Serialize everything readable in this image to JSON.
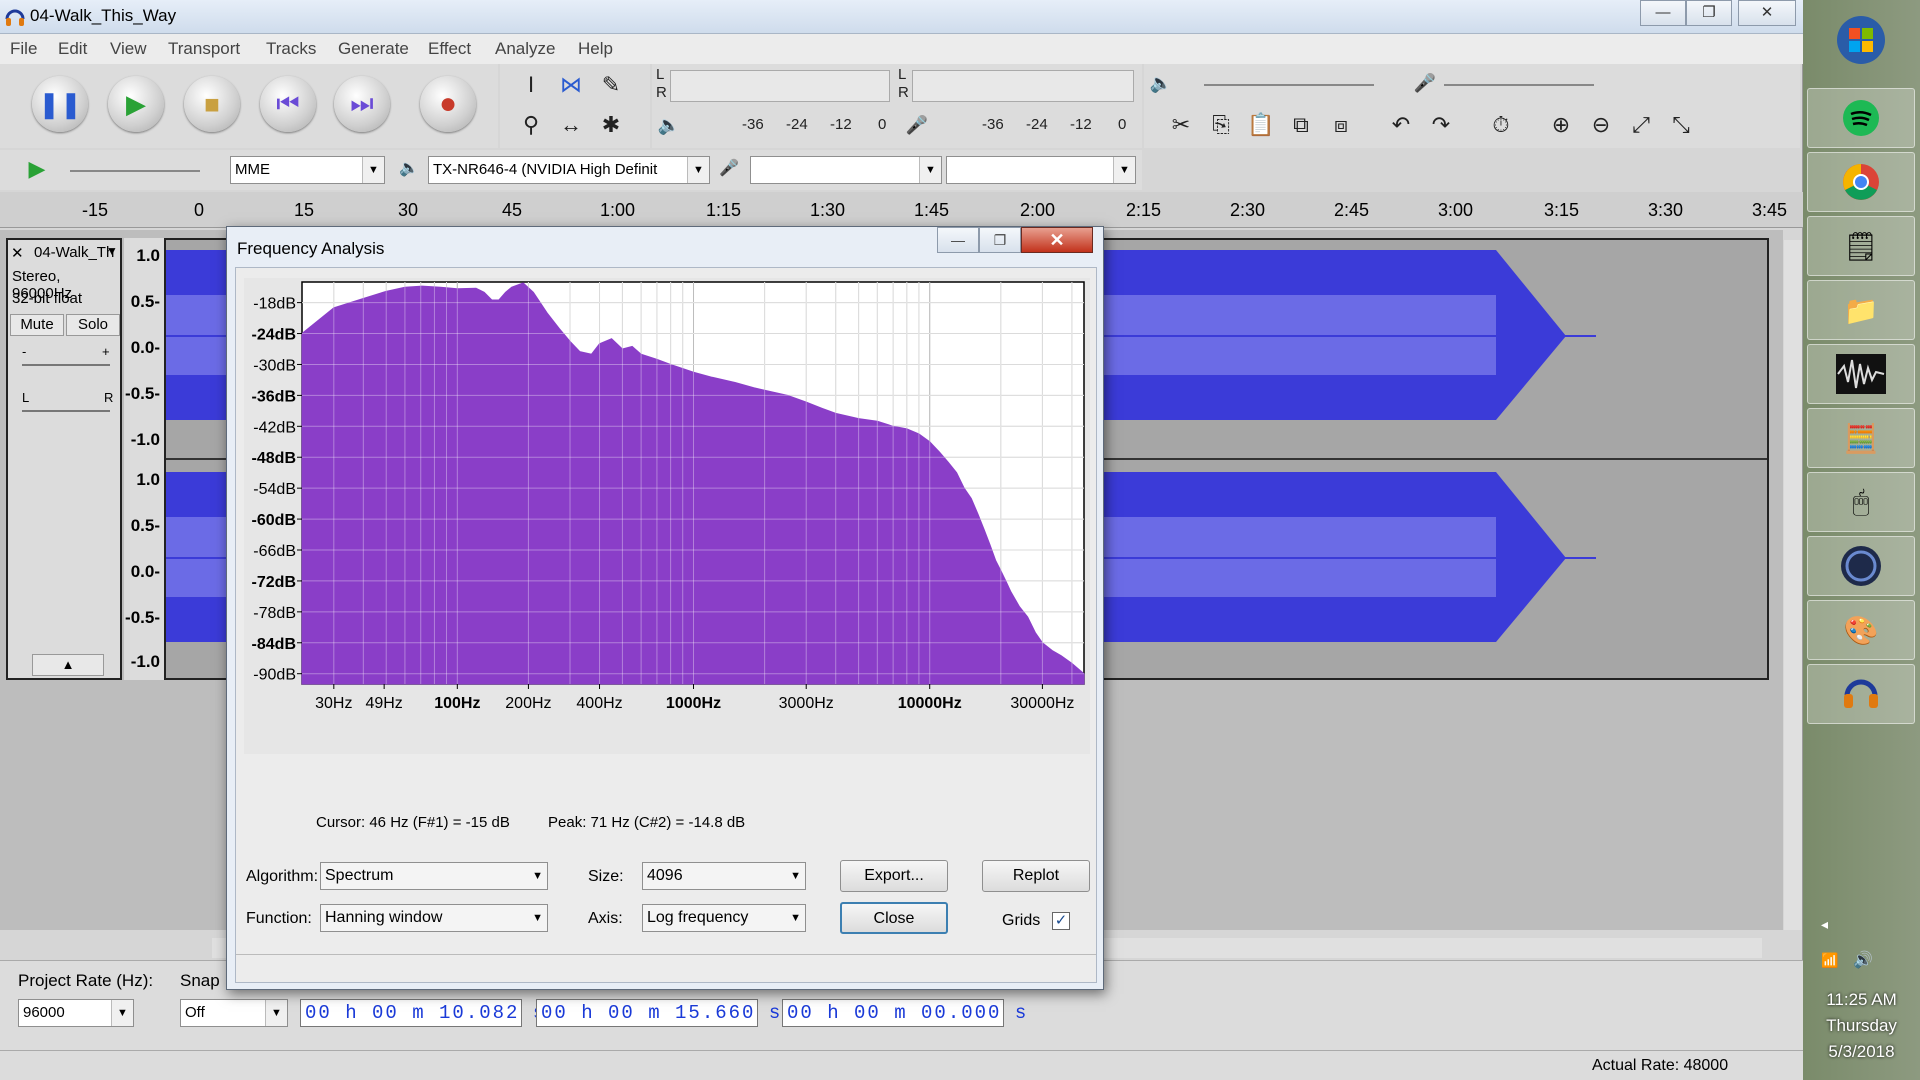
{
  "window": {
    "title": "04-Walk_This_Way",
    "menu": [
      "File",
      "Edit",
      "View",
      "Transport",
      "Tracks",
      "Generate",
      "Effect",
      "Analyze",
      "Help"
    ]
  },
  "meters": {
    "rec_ticks": [
      "-36",
      "-24",
      "-12",
      "0"
    ],
    "play_ticks": [
      "-36",
      "-24",
      "-12",
      "0"
    ],
    "channel_L": "L",
    "channel_R": "R"
  },
  "device": {
    "host": "MME",
    "output": "TX-NR646-4 (NVIDIA High Definit",
    "input": "",
    "channels": ""
  },
  "timeline": {
    "ticks": [
      "-15",
      "0",
      "15",
      "30",
      "45",
      "1:00",
      "1:15",
      "1:30",
      "1:45",
      "2:00",
      "2:15",
      "2:30",
      "2:45",
      "3:00",
      "3:15",
      "3:30",
      "3:45"
    ]
  },
  "track": {
    "name": "04-Walk_Th",
    "info1": "Stereo, 96000Hz",
    "info2": "32-bit float",
    "mute": "Mute",
    "solo": "Solo",
    "gain_minus": "-",
    "gain_plus": "+",
    "pan_left": "L",
    "pan_right": "R",
    "scale": [
      "1.0",
      "0.5-",
      "0.0-",
      "-0.5-",
      "-1.0",
      "1.0",
      "0.5-",
      "0.0-",
      "-0.5-",
      "-1.0"
    ]
  },
  "selection": {
    "project_rate_label": "Project Rate (Hz):",
    "project_rate": "96000",
    "snap_label": "Snap",
    "snap_value": "Off",
    "start": "00 h 00 m 10.082 s",
    "end": "00 h 00 m 15.660 s",
    "audio_position": "00 h 00 m 00.000 s"
  },
  "status": {
    "actual_rate": "Actual Rate: 48000"
  },
  "clock": {
    "time": "11:25 AM",
    "day": "Thursday",
    "date": "5/3/2018"
  },
  "dialog": {
    "title": "Frequency Analysis",
    "cursor_text": "Cursor: 46 Hz (F#1) = -15 dB",
    "peak_text": "Peak: 71 Hz (C#2) = -14.8 dB",
    "algorithm_label": "Algorithm:",
    "algorithm": "Spectrum",
    "size_label": "Size:",
    "size": "4096",
    "function_label": "Function:",
    "function": "Hanning window",
    "axis_label": "Axis:",
    "axis": "Log frequency",
    "export_label": "Export...",
    "replot_label": "Replot",
    "close_label": "Close",
    "grids_label": "Grids",
    "grids_checked": true
  },
  "chart_data": {
    "type": "area",
    "xlabel": "",
    "ylabel": "",
    "x_scale": "log",
    "xlim": [
      22,
      45000
    ],
    "ylim": [
      -92,
      -14
    ],
    "grid": true,
    "y_tick_labels": [
      "-18dB",
      "-24dB",
      "-30dB",
      "-36dB",
      "-42dB",
      "-48dB",
      "-54dB",
      "-60dB",
      "-66dB",
      "-72dB",
      "-78dB",
      "-84dB",
      "-90dB"
    ],
    "y_ticks": [
      -18,
      -24,
      -30,
      -36,
      -42,
      -48,
      -54,
      -60,
      -66,
      -72,
      -78,
      -84,
      -90
    ],
    "x_tick_labels": [
      "30Hz",
      "49Hz",
      "100Hz",
      "200Hz",
      "400Hz",
      "1000Hz",
      "3000Hz",
      "10000Hz",
      "30000Hz"
    ],
    "x_ticks": [
      30,
      49,
      100,
      200,
      400,
      1000,
      3000,
      10000,
      30000
    ],
    "color": "#8a3ec8",
    "series": [
      {
        "x": [
          22,
          30,
          40,
          50,
          60,
          71,
          85,
          100,
          120,
          130,
          140,
          150,
          160,
          170,
          190,
          210,
          240,
          270,
          300,
          330,
          370,
          400,
          450,
          500,
          550,
          600,
          700,
          800,
          1000,
          1200,
          1500,
          1800,
          2000,
          2500,
          3000,
          3500,
          4000,
          5000,
          6000,
          7000,
          8000,
          9000,
          10000,
          11000,
          12000,
          13000,
          14000,
          15000,
          16000,
          17000,
          18000,
          19000,
          20000,
          21000,
          22000,
          24000,
          26000,
          28000,
          30000,
          33000,
          36000,
          40000,
          45000
        ],
        "y": [
          -24,
          -19,
          -17.2,
          -15.8,
          -15,
          -14.8,
          -15,
          -15.3,
          -15.2,
          -16,
          -17.5,
          -17.5,
          -16,
          -15,
          -14.2,
          -16,
          -20,
          -23,
          -25.5,
          -27.5,
          -28,
          -26,
          -25,
          -27,
          -26.5,
          -28,
          -29,
          -30,
          -31.5,
          -32.5,
          -33.5,
          -34.5,
          -35,
          -36,
          -37.3,
          -38.5,
          -39.5,
          -40.5,
          -41,
          -42,
          -42.5,
          -43.5,
          -45,
          -47,
          -49,
          -51,
          -54,
          -56,
          -59,
          -62,
          -65,
          -68,
          -70,
          -72,
          -74,
          -77,
          -79,
          -82,
          -84,
          -85.5,
          -86.5,
          -88,
          -90
        ]
      }
    ]
  }
}
